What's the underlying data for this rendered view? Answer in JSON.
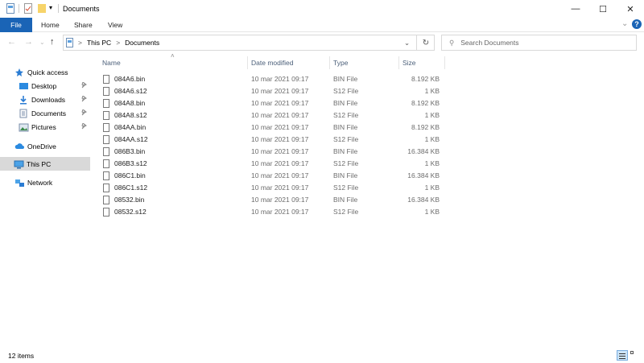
{
  "window": {
    "title": "Documents",
    "minimize": "—",
    "maximize": "☐",
    "close": "✕"
  },
  "ribbon": {
    "tabs": [
      "File",
      "Home",
      "Share",
      "View"
    ],
    "help": "?",
    "expand": "⌄"
  },
  "address": {
    "sep": ">",
    "crumbs": [
      "This PC",
      "Documents"
    ],
    "dropdown": "⌄",
    "refresh": "↻"
  },
  "search": {
    "placeholder": "Search Documents"
  },
  "nav": {
    "back": "←",
    "forward": "→",
    "recent": "⌄",
    "up": "↑"
  },
  "sidebar": {
    "items": [
      {
        "label": "Quick access",
        "icon": "star-icon",
        "pinned": false
      },
      {
        "label": "Desktop",
        "icon": "desktop-icon",
        "pinned": true
      },
      {
        "label": "Downloads",
        "icon": "download-icon",
        "pinned": true
      },
      {
        "label": "Documents",
        "icon": "documents-icon",
        "pinned": true
      },
      {
        "label": "Pictures",
        "icon": "pictures-icon",
        "pinned": true
      },
      {
        "label": "OneDrive",
        "icon": "cloud-icon",
        "pinned": false
      },
      {
        "label": "This PC",
        "icon": "pc-icon",
        "pinned": false,
        "selected": true
      },
      {
        "label": "Network",
        "icon": "network-icon",
        "pinned": false
      }
    ]
  },
  "columns": {
    "name": "Name",
    "date": "Date modified",
    "type": "Type",
    "size": "Size"
  },
  "files": [
    {
      "name": "084A6.bin",
      "date": "10 mar 2021 09:17",
      "type": "BIN File",
      "size": "8.192 KB"
    },
    {
      "name": "084A6.s12",
      "date": "10 mar 2021 09:17",
      "type": "S12 File",
      "size": "1 KB"
    },
    {
      "name": "084A8.bin",
      "date": "10 mar 2021 09:17",
      "type": "BIN File",
      "size": "8.192 KB"
    },
    {
      "name": "084A8.s12",
      "date": "10 mar 2021 09:17",
      "type": "S12 File",
      "size": "1 KB"
    },
    {
      "name": "084AA.bin",
      "date": "10 mar 2021 09:17",
      "type": "BIN File",
      "size": "8.192 KB"
    },
    {
      "name": "084AA.s12",
      "date": "10 mar 2021 09:17",
      "type": "S12 File",
      "size": "1 KB"
    },
    {
      "name": "086B3.bin",
      "date": "10 mar 2021 09:17",
      "type": "BIN File",
      "size": "16.384 KB"
    },
    {
      "name": "086B3.s12",
      "date": "10 mar 2021 09:17",
      "type": "S12 File",
      "size": "1 KB"
    },
    {
      "name": "086C1.bin",
      "date": "10 mar 2021 09:17",
      "type": "BIN File",
      "size": "16.384 KB"
    },
    {
      "name": "086C1.s12",
      "date": "10 mar 2021 09:17",
      "type": "S12 File",
      "size": "1 KB"
    },
    {
      "name": "08532.bin",
      "date": "10 mar 2021 09:17",
      "type": "BIN File",
      "size": "16.384 KB"
    },
    {
      "name": "08532.s12",
      "date": "10 mar 2021 09:17",
      "type": "S12 File",
      "size": "1 KB"
    }
  ],
  "status": {
    "count": "12 items"
  },
  "colors": {
    "accent": "#1a64b6",
    "selected": "#d9d9d9",
    "header_text": "#4c607a"
  }
}
